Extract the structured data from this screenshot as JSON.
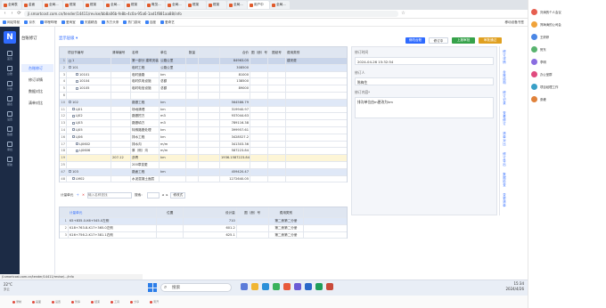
{
  "browser": {
    "tabs": [
      "全局表",
      "金面",
      "全局...",
      "框架",
      "框架",
      "全局...",
      "框架",
      "概览...",
      "全局...",
      "框架",
      "框架",
      "全局...",
      "用户中",
      "全局..."
    ],
    "url": "jl.smartcost.com.cn/tender/14411/revise/bb8a06b-fe8b-4c0a-95a6-1ad1f881aa88/info",
    "bookmarks": [
      "网站导航",
      "京东",
      "哔哩哔哩",
      "爱淘宝",
      "天猫精选",
      "东方头条",
      "热门游戏",
      "百度",
      "爱奇艺"
    ],
    "right_label": "移动设备书签"
  },
  "app": {
    "logo": "N",
    "side_items": [
      "首页",
      "台账",
      "计量",
      "报表",
      "设置",
      "数据",
      "审批",
      "帮助"
    ],
    "subnav_title": "台账修订",
    "subnav_items": [
      "台账修订",
      "修订详情",
      "数据对比",
      "清单对比"
    ],
    "breadcrumb": "显示层级 ▾",
    "toolbar": [
      "修改台账",
      "修订中",
      "上报审批",
      "审批通过"
    ]
  },
  "table": {
    "headers": [
      "",
      "项目节编号",
      "清单编号",
      "名称",
      "单位",
      "数量",
      "合价",
      "图（册）号",
      "图纸号",
      "费用类别"
    ],
    "rows": [
      {
        "n": "1",
        "code": "1",
        "bill": "",
        "name": "第一部分 建筑安装工程费",
        "unit": "公路公里",
        "qty": "",
        "total": "84963.05",
        "drawing": "",
        "fig": "",
        "type": "建安费",
        "style": "band"
      },
      {
        "n": "2",
        "code": "101",
        "bill": "",
        "name": "临时工程",
        "unit": "公路公里",
        "qty": "",
        "total": "308500",
        "drawing": "",
        "fig": "",
        "type": "",
        "style": "sel"
      },
      {
        "n": "3",
        "code": "10101",
        "bill": "",
        "name": "临时道路",
        "unit": "km",
        "qty": "",
        "total": "81000",
        "drawing": "",
        "fig": "",
        "type": "",
        "style": ""
      },
      {
        "n": "4",
        "code": "10104",
        "bill": "",
        "name": "临时供电设施",
        "unit": "总额",
        "qty": "",
        "total": "138500",
        "drawing": "",
        "fig": "",
        "type": "",
        "style": ""
      },
      {
        "n": "5",
        "code": "10105",
        "bill": "",
        "name": "临时电信设施",
        "unit": "总额",
        "qty": "",
        "total": "89000",
        "drawing": "",
        "fig": "",
        "type": "",
        "style": ""
      },
      {
        "n": "6",
        "code": "",
        "bill": "",
        "name": "",
        "unit": "",
        "qty": "",
        "total": "",
        "drawing": "",
        "fig": "",
        "type": "",
        "style": ""
      },
      {
        "n": "10",
        "code": "102",
        "bill": "",
        "name": "路基工程",
        "unit": "km",
        "qty": "",
        "total": "564586.79",
        "drawing": "",
        "fig": "",
        "type": "",
        "style": "sel"
      },
      {
        "n": "11",
        "code": "LJ01",
        "bill": "",
        "name": "场地清理",
        "unit": "km",
        "qty": "",
        "total": "319940.97",
        "drawing": "",
        "fig": "",
        "type": "",
        "style": ""
      },
      {
        "n": "12",
        "code": "LJ02",
        "bill": "",
        "name": "路基挖方",
        "unit": "m3",
        "qty": "",
        "total": "937044.63",
        "drawing": "",
        "fig": "",
        "type": "",
        "style": ""
      },
      {
        "n": "13",
        "code": "LJ03",
        "bill": "",
        "name": "路基填方",
        "unit": "m3",
        "qty": "",
        "total": "789116.38",
        "drawing": "",
        "fig": "",
        "type": "",
        "style": ""
      },
      {
        "n": "14",
        "code": "LJ05",
        "bill": "",
        "name": "特殊路基处理",
        "unit": "km",
        "qty": "",
        "total": "399957.61",
        "drawing": "",
        "fig": "",
        "type": "",
        "style": ""
      },
      {
        "n": "16",
        "code": "LJ06",
        "bill": "",
        "name": "排水工程",
        "unit": "km",
        "qty": "",
        "total": "3428527.2",
        "drawing": "",
        "fig": "",
        "type": "",
        "style": ""
      },
      {
        "n": "17",
        "code": "LJ0602",
        "bill": "",
        "name": "排水沟",
        "unit": "m/m",
        "qty": "",
        "total": "341303.36",
        "drawing": "",
        "fig": "",
        "type": "",
        "style": ""
      },
      {
        "n": "18",
        "code": "LJ0606",
        "bill": "",
        "name": "厚（侧）沟",
        "unit": "m/m",
        "qty": "",
        "total": "587223.84",
        "drawing": "",
        "fig": "",
        "type": "",
        "style": ""
      },
      {
        "n": "19",
        "code": "",
        "bill": "207-12",
        "name": "沥青",
        "unit": "km",
        "qty": "819.72",
        "total": "1936.1587223.84",
        "drawing": "",
        "fig": "",
        "type": "",
        "style": "hl"
      },
      {
        "n": "25",
        "code": "",
        "bill": "",
        "name": "200章变更",
        "unit": "",
        "qty": "",
        "total": "",
        "drawing": "",
        "fig": "",
        "type": "",
        "style": ""
      },
      {
        "n": "47",
        "code": "103",
        "bill": "",
        "name": "路面工程",
        "unit": "km",
        "qty": "",
        "total": "459420.47",
        "drawing": "",
        "fig": "",
        "type": "",
        "style": "sel"
      },
      {
        "n": "48",
        "code": "LM02",
        "bill": "",
        "name": "水泥混凝土面层",
        "unit": "",
        "qty": "",
        "total": "1272640.05",
        "drawing": "",
        "fig": "",
        "type": "",
        "style": ""
      }
    ]
  },
  "bottom": {
    "title": "计量单元",
    "input_placeholder": "输入名称查找",
    "search_label": "搜索：",
    "formula_label": "修改式",
    "headers": [
      "",
      "计量单元",
      "位置",
      "设计量",
      "图（册）号",
      "费用类别"
    ],
    "rows": [
      {
        "n": "1",
        "unit": "K5+835.0-K6+545.0左侧",
        "pos": "",
        "qty": "710",
        "fig": "第二册第二分册",
        "type": ""
      },
      {
        "n": "2",
        "unit": "K18+763.8-K17+365.0左侧",
        "pos": "",
        "qty": "601.2",
        "fig": "第二册第二分册",
        "type": ""
      },
      {
        "n": "3",
        "unit": "K16+756.2-K17+381.1右侧",
        "pos": "",
        "qty": "625.1",
        "fig": "第二册第二分册",
        "type": ""
      }
    ]
  },
  "side_form": {
    "time_label": "修订时间",
    "time_value": "2024-04-26 15:32:54",
    "person_label": "修订人",
    "person_value": "陈梅生",
    "reason_label": "修订内容*",
    "reason_value": "排沟单位由m更改为km",
    "strip": [
      "修订详情",
      "台账结构",
      "修订记录",
      "查看修订",
      "清单对比",
      "修订导出",
      "数据检查",
      "变更清单"
    ]
  },
  "status_url": "jl.smartcost.com.cn/tender/14411/revise/.../info",
  "taskbar": {
    "search": "搜索",
    "weather": "22°C",
    "weather_sub": "多云",
    "time": "15:34",
    "date": "2024/4/26"
  },
  "chat": [
    {
      "name": "刘涛的个人会议",
      "color": "#e65f50"
    },
    {
      "name": "郑海涛的公司会",
      "color": "#f0a33a"
    },
    {
      "name": "王婷婷",
      "color": "#4b87e5"
    },
    {
      "name": "贺东",
      "color": "#59b36f"
    },
    {
      "name": "李明",
      "color": "#8a6de0"
    },
    {
      "name": "办公室群",
      "color": "#e04b7f"
    },
    {
      "name": "项目经理工作",
      "color": "#3aa0c7"
    },
    {
      "name": "张峰",
      "color": "#e0823b"
    }
  ],
  "dock": [
    "录制",
    "画面",
    "设置",
    "暂停",
    "结束",
    "工具",
    "分享",
    "离开"
  ]
}
